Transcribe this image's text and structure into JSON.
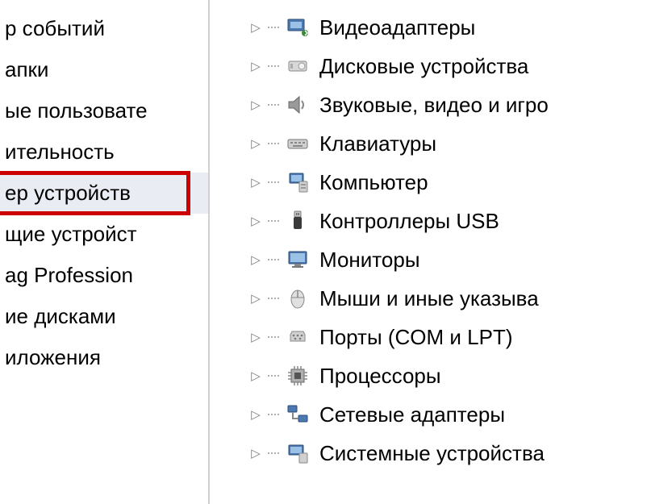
{
  "sidebar": {
    "items": [
      {
        "label": "р событий"
      },
      {
        "label": "апки"
      },
      {
        "label": "ые пользовате"
      },
      {
        "label": "ительность"
      },
      {
        "label": "ер устройств",
        "highlighted": true
      },
      {
        "label": "щие устройст"
      },
      {
        "label": "ag Profession"
      },
      {
        "label": "ие дисками"
      },
      {
        "label": "иложения"
      }
    ]
  },
  "devices": {
    "items": [
      {
        "icon": "display-adapter",
        "label": "Видеоадаптеры"
      },
      {
        "icon": "disk-drive",
        "label": "Дисковые устройства"
      },
      {
        "icon": "speaker",
        "label": "Звуковые, видео и игро"
      },
      {
        "icon": "keyboard",
        "label": "Клавиатуры"
      },
      {
        "icon": "computer",
        "label": "Компьютер"
      },
      {
        "icon": "usb",
        "label": "Контроллеры USB"
      },
      {
        "icon": "monitor",
        "label": "Мониторы"
      },
      {
        "icon": "mouse",
        "label": "Мыши и иные указыва"
      },
      {
        "icon": "port",
        "label": "Порты (COM и LPT)"
      },
      {
        "icon": "processor",
        "label": "Процессоры"
      },
      {
        "icon": "network",
        "label": "Сетевые адаптеры"
      },
      {
        "icon": "system",
        "label": "Системные устройства"
      }
    ]
  }
}
